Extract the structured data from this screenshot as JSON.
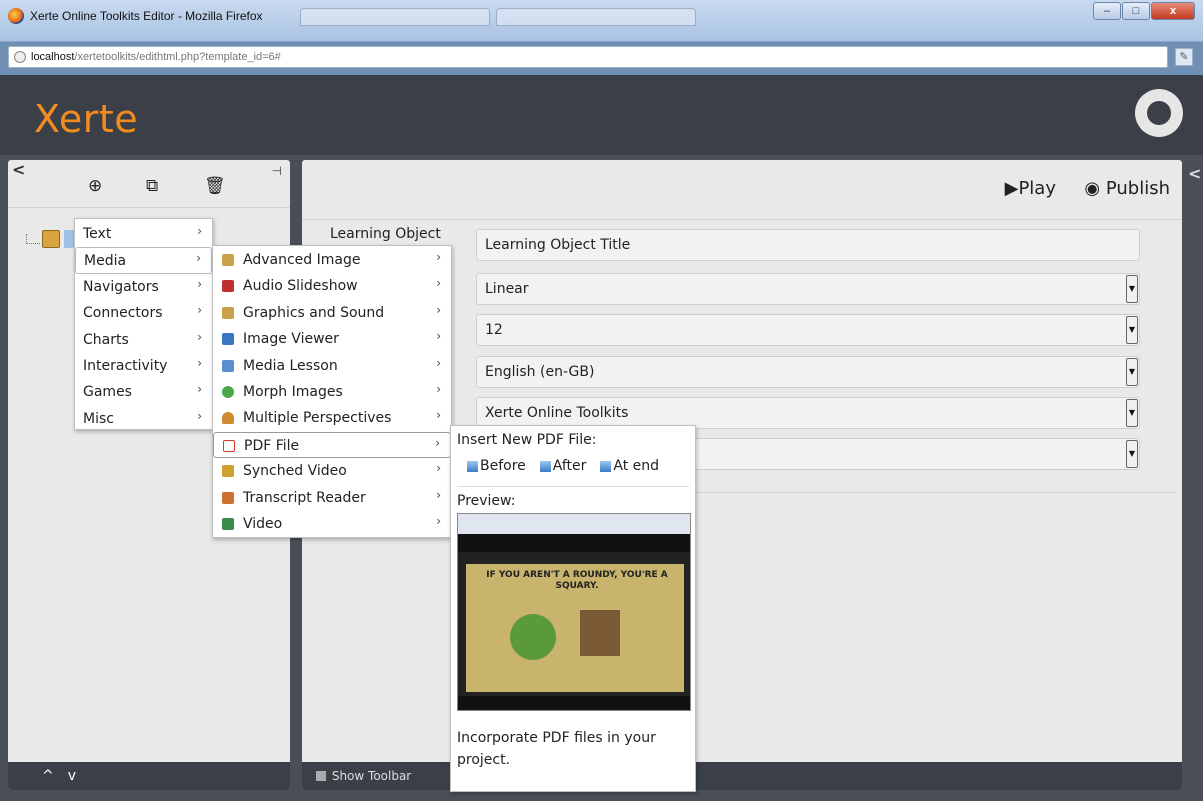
{
  "window": {
    "title": "Xerte Online Toolkits Editor - Mozilla Firefox",
    "url_host": "localhost",
    "url_path": "/xertetoolkits/edithtml.php?template_id=6#",
    "min_label": "–",
    "max_label": "□",
    "close_label": "x"
  },
  "header": {
    "logo_text": "Xerte"
  },
  "left_panel": {
    "add_icon": "⊕",
    "copy_icon": "⧉",
    "delete_icon": "🗑",
    "collapse_icon": "<",
    "pin_icon": "⊣",
    "nav_up": "^",
    "nav_down": "v"
  },
  "right_panel": {
    "play_label": "Play",
    "publish_label": "Publish",
    "collapse_icon": "<",
    "field_label": "Learning Object",
    "fields": [
      "Learning Object Title",
      "Linear",
      "12",
      "English (en-GB)",
      "Xerte Online Toolkits",
      ""
    ],
    "show_toolbar_label": "Show Toolbar"
  },
  "menu_categories": [
    "Text",
    "Media",
    "Navigators",
    "Connectors",
    "Charts",
    "Interactivity",
    "Games",
    "Misc"
  ],
  "media_items": [
    {
      "label": "Advanced Image",
      "icon": "image-icon",
      "color": "#c8a24a"
    },
    {
      "label": "Audio Slideshow",
      "icon": "speaker-icon",
      "color": "#c03030"
    },
    {
      "label": "Graphics and Sound",
      "icon": "graphics-icon",
      "color": "#c8a24a"
    },
    {
      "label": "Image Viewer",
      "icon": "viewer-icon",
      "color": "#3a76c4"
    },
    {
      "label": "Media Lesson",
      "icon": "media-icon",
      "color": "#5a8fd0"
    },
    {
      "label": "Morph Images",
      "icon": "morph-icon",
      "color": "#4aa64a"
    },
    {
      "label": "Multiple Perspectives",
      "icon": "person-icon",
      "color": "#d08a30"
    },
    {
      "label": "PDF File",
      "icon": "pdf-icon",
      "color": "#d23a2a"
    },
    {
      "label": "Synched Video",
      "icon": "synched-video-icon",
      "color": "#d0a030"
    },
    {
      "label": "Transcript Reader",
      "icon": "transcript-icon",
      "color": "#d07030"
    },
    {
      "label": "Video",
      "icon": "film-icon",
      "color": "#3a8a4a"
    }
  ],
  "preview": {
    "insert_heading": "Insert New PDF File:",
    "before_label": "Before",
    "after_label": "After",
    "at_end_label": "At end",
    "preview_heading": "Preview:",
    "thumb_title": "IF YOU AREN'T A ROUNDY, YOU'RE A SQUARY.",
    "description": "Incorporate PDF files in your project."
  }
}
